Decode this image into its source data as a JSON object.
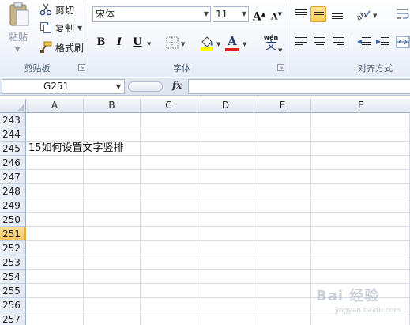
{
  "ribbon": {
    "clipboard": {
      "paste_label": "粘贴",
      "cut_label": "剪切",
      "copy_label": "复制",
      "format_painter_label": "格式刷",
      "group_label": "剪贴板"
    },
    "font": {
      "font_name": "宋体",
      "font_size": "11",
      "bold": "B",
      "italic": "I",
      "underline": "U",
      "grow": "A",
      "shrink": "A",
      "font_color_glyph": "A",
      "phonetic_glyph": "wén",
      "phonetic_char": "文",
      "group_label": "字体"
    },
    "alignment": {
      "group_label": "对齐方式"
    }
  },
  "formula_bar": {
    "name_box_value": "G251",
    "fx_label": "fx",
    "formula_value": ""
  },
  "columns": [
    "A",
    "B",
    "C",
    "D",
    "E",
    "F"
  ],
  "rows": [
    {
      "num": "243",
      "text": ""
    },
    {
      "num": "244",
      "text": ""
    },
    {
      "num": "245",
      "text": "15如何设置文字竖排"
    },
    {
      "num": "246",
      "text": ""
    },
    {
      "num": "247",
      "text": ""
    },
    {
      "num": "248",
      "text": ""
    },
    {
      "num": "249",
      "text": ""
    },
    {
      "num": "250",
      "text": ""
    },
    {
      "num": "251",
      "text": ""
    },
    {
      "num": "252",
      "text": ""
    },
    {
      "num": "253",
      "text": ""
    },
    {
      "num": "254",
      "text": ""
    },
    {
      "num": "255",
      "text": ""
    },
    {
      "num": "256",
      "text": ""
    },
    {
      "num": "257",
      "text": ""
    }
  ],
  "selected_row": "251",
  "watermark": {
    "text": "Bai  经验",
    "sub": "jingyan.baidu.com"
  },
  "colors": {
    "selection_accent": "#f7c55e",
    "header_blue": "#dee6f0",
    "font_color_red": "#e0201b",
    "highlight_yellow": "#ffff00"
  }
}
